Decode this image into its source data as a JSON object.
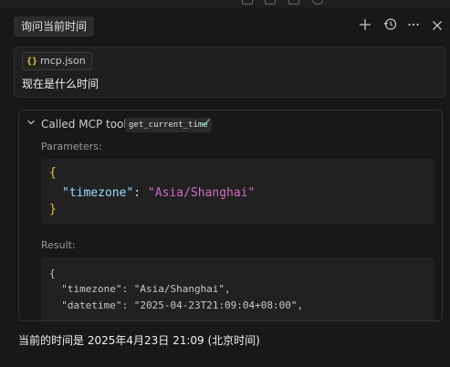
{
  "header": {
    "title": "询问当前时间",
    "actions": [
      "plus-icon",
      "history-icon",
      "more-icon",
      "close-icon"
    ]
  },
  "user_message": {
    "attachment": {
      "icon": "json-braces-icon",
      "glyph": "{}",
      "label": "mcp.json"
    },
    "text": "现在是什么时间"
  },
  "tool_call": {
    "prefix": "Called MCP tool",
    "tool_name": "get_current_time",
    "status_icon": "check-icon",
    "parameters_label": "Parameters:",
    "parameters": {
      "open": "{",
      "key": "\"timezone\"",
      "colon": ": ",
      "value": "\"Asia/Shanghai\"",
      "close": "}"
    },
    "result_label": "Result:",
    "result_lines": [
      "{",
      "  \"timezone\": \"Asia/Shanghai\",",
      "  \"datetime\": \"2025-04-23T21:09:04+08:00\","
    ]
  },
  "answer": "当前的时间是 2025年4月23日 21:09 (北京时间)",
  "colors": {
    "background": "#181818",
    "check": "#4ec9b0",
    "json_key": "#9cdcfe",
    "json_string": "#ce6dbd",
    "json_brace": "#e8c246"
  }
}
